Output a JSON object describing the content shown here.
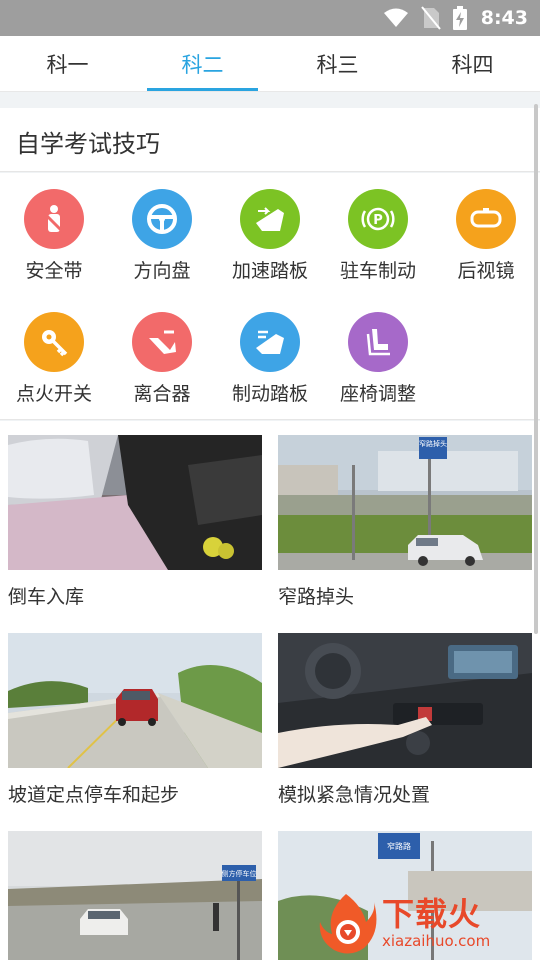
{
  "status_bar": {
    "time": "8:43",
    "icons": [
      "wifi-icon",
      "no-sim-icon",
      "battery-charging-icon"
    ]
  },
  "tabs": [
    {
      "label": "科一",
      "active": false
    },
    {
      "label": "科二",
      "active": true
    },
    {
      "label": "科三",
      "active": false
    },
    {
      "label": "科四",
      "active": false
    }
  ],
  "section": {
    "title": "自学考试技巧"
  },
  "skills": [
    {
      "label": "安全带",
      "icon": "seatbelt-icon",
      "color": "#f26a6a"
    },
    {
      "label": "方向盘",
      "icon": "steering-wheel-icon",
      "color": "#3ea4e6"
    },
    {
      "label": "加速踏板",
      "icon": "accelerator-pedal-icon",
      "color": "#7cc324"
    },
    {
      "label": "驻车制动",
      "icon": "parking-brake-icon",
      "color": "#7cc324"
    },
    {
      "label": "后视镜",
      "icon": "rearview-mirror-icon",
      "color": "#f5a21c"
    },
    {
      "label": "点火开关",
      "icon": "ignition-key-icon",
      "color": "#f5a21c"
    },
    {
      "label": "离合器",
      "icon": "clutch-icon",
      "color": "#f26a6a"
    },
    {
      "label": "制动踏板",
      "icon": "brake-pedal-icon",
      "color": "#3ea4e6"
    },
    {
      "label": "座椅调整",
      "icon": "seat-adjust-icon",
      "color": "#a669c9"
    }
  ],
  "lessons": [
    {
      "label": "倒车入库"
    },
    {
      "label": "窄路掉头"
    },
    {
      "label": "坡道定点停车和起步"
    },
    {
      "label": "模拟紧急情况处置"
    },
    {
      "label": ""
    },
    {
      "label": ""
    }
  ],
  "photo_signs": {
    "narrow_road": "窄路掉头",
    "parking_sign": "侧方停车位",
    "placeholder_sign": "窄路路"
  },
  "watermark": {
    "cn": "下载火",
    "en": "xiazaihuo.com"
  }
}
